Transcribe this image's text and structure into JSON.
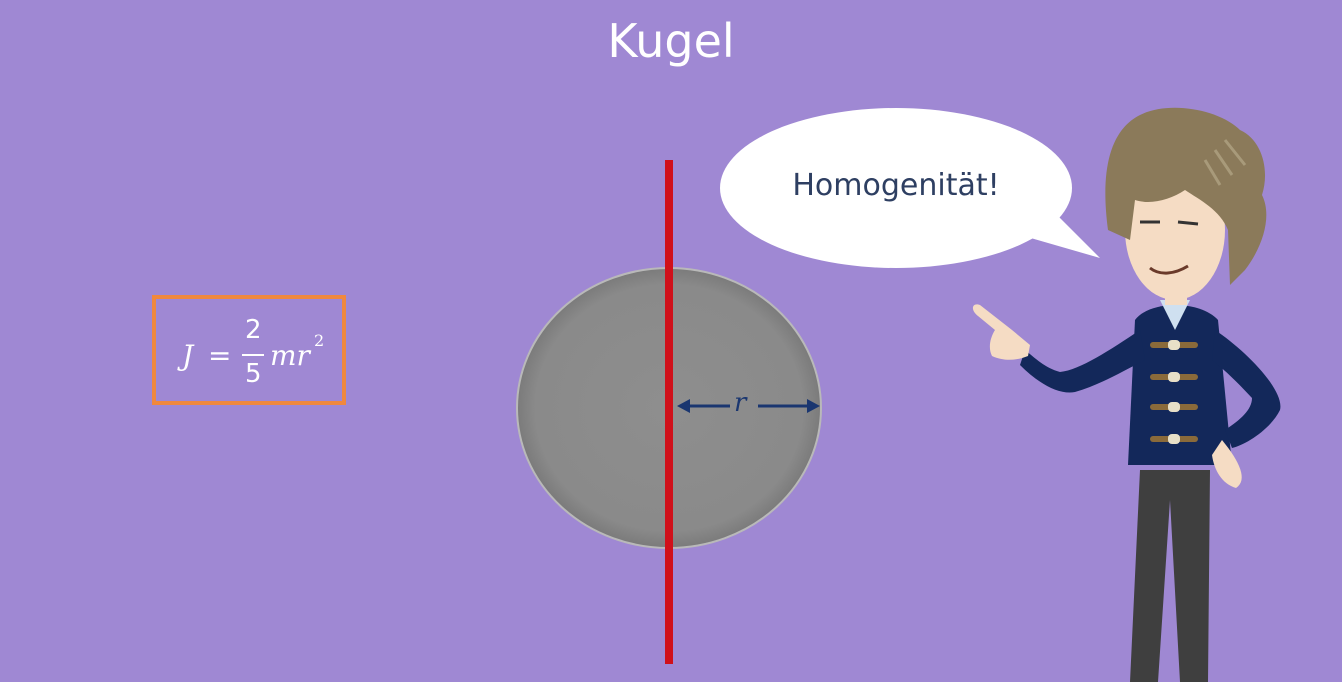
{
  "slide": {
    "title": "Kugel",
    "formula": {
      "lhs": "J",
      "equals": "=",
      "numerator": "2",
      "denominator": "5",
      "rhs": "mr",
      "exponent": "2"
    },
    "radius_label": "r",
    "speech_bubble": "Homogenität!"
  },
  "colors": {
    "background": "#9f88d3",
    "formula_border": "#f0883d",
    "axis": "#d0101a",
    "sphere": "#8b8b8b",
    "arrow": "#1a3670"
  }
}
